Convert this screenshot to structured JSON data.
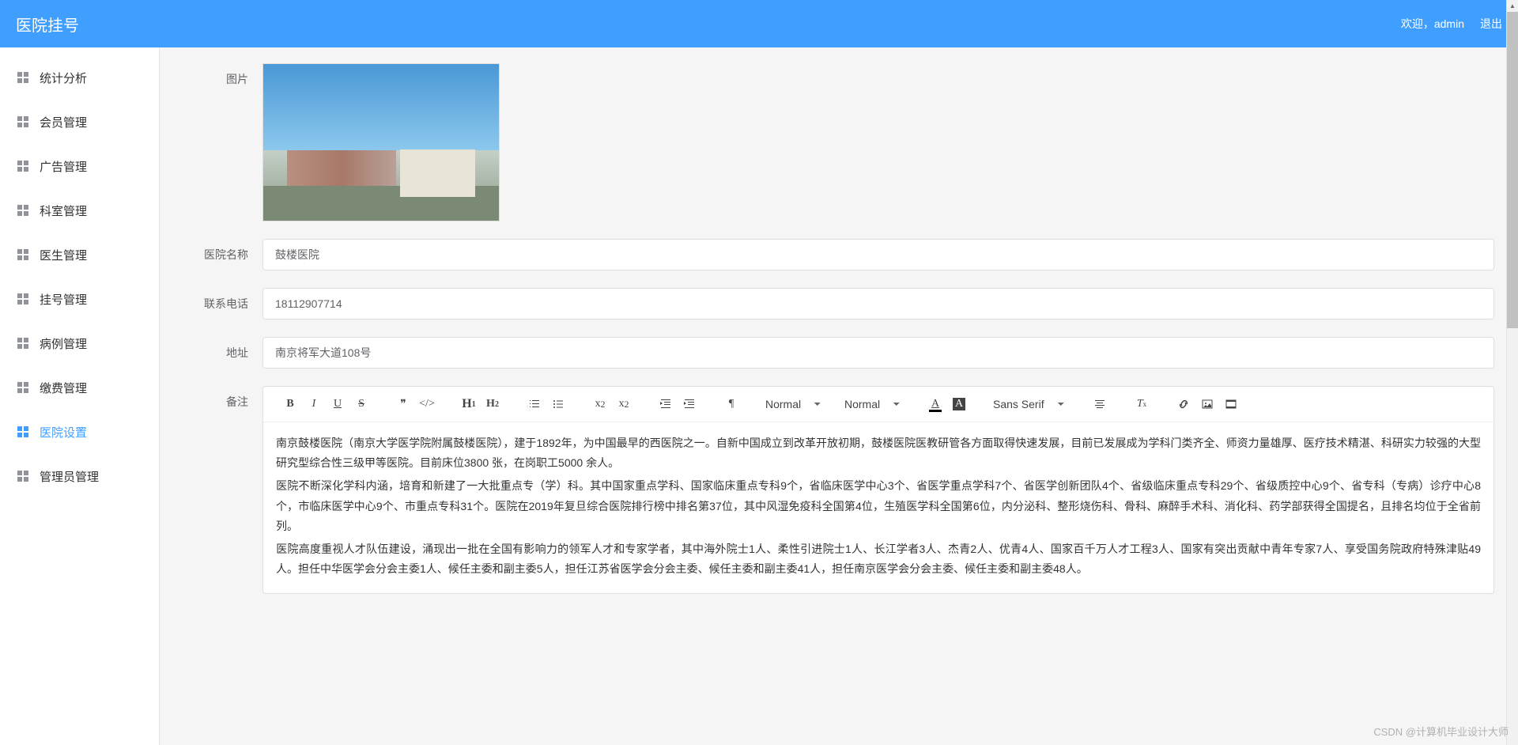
{
  "header": {
    "title": "医院挂号",
    "welcome": "欢迎，",
    "user": "admin",
    "logout": "退出"
  },
  "sidebar": {
    "items": [
      {
        "label": "统计分析"
      },
      {
        "label": "会员管理"
      },
      {
        "label": "广告管理"
      },
      {
        "label": "科室管理"
      },
      {
        "label": "医生管理"
      },
      {
        "label": "挂号管理"
      },
      {
        "label": "病例管理"
      },
      {
        "label": "缴费管理"
      },
      {
        "label": "医院设置"
      },
      {
        "label": "管理员管理"
      }
    ]
  },
  "form": {
    "labels": {
      "photo": "图片",
      "name": "医院名称",
      "phone": "联系电话",
      "address": "地址",
      "remark": "备注"
    },
    "values": {
      "name": "鼓楼医院",
      "phone": "18112907714",
      "address": "南京将军大道108号"
    }
  },
  "toolbar": {
    "normal1": "Normal",
    "normal2": "Normal",
    "font": "Sans Serif"
  },
  "content": {
    "p1": "南京鼓楼医院（南京大学医学院附属鼓楼医院），建于1892年，为中国最早的西医院之一。自新中国成立到改革开放初期，鼓楼医院医教研管各方面取得快速发展，目前已发展成为学科门类齐全、师资力量雄厚、医疗技术精湛、科研实力较强的大型研究型综合性三级甲等医院。目前床位3800 张，在岗职工5000  余人。",
    "p2": "医院不断深化学科内涵，培育和新建了一大批重点专（学）科。其中国家重点学科、国家临床重点专科9个，省临床医学中心3个、省医学重点学科7个、省医学创新团队4个、省级临床重点专科29个、省级质控中心9个、省专科（专病）诊疗中心8个，市临床医学中心9个、市重点专科31个。医院在2019年复旦综合医院排行榜中排名第37位，其中风湿免疫科全国第4位，生殖医学科全国第6位，内分泌科、整形烧伤科、骨科、麻醉手术科、消化科、药学部获得全国提名，且排名均位于全省前列。",
    "p3": "医院高度重视人才队伍建设，涌现出一批在全国有影响力的领军人才和专家学者，其中海外院士1人、柔性引进院士1人、长江学者3人、杰青2人、优青4人、国家百千万人才工程3人、国家有突出贡献中青年专家7人、享受国务院政府特殊津贴49人。担任中华医学会分会主委1人、候任主委和副主委5人，担任江苏省医学会分会主委、候任主委和副主委41人，担任南京医学会分会主委、候任主委和副主委48人。"
  },
  "watermark": "CSDN @计算机毕业设计大师"
}
